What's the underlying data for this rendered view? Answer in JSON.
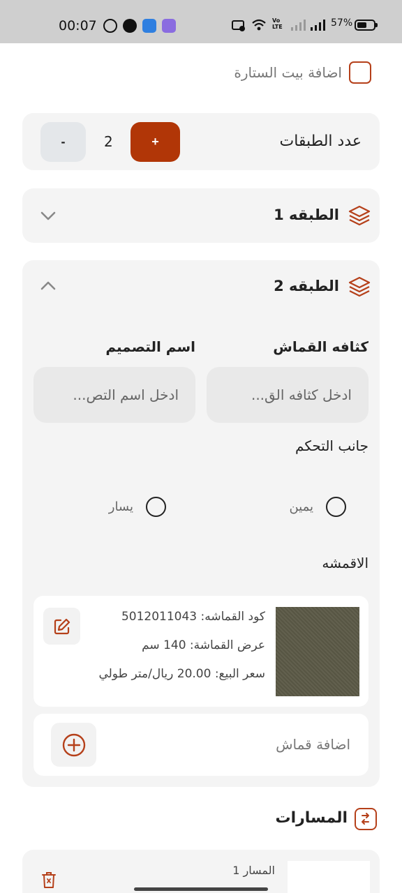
{
  "status_bar": {
    "time": "00:07",
    "battery_percent": "57%",
    "battery_level": 0.57,
    "network_label": "Vo LTE"
  },
  "add_curtain_house": {
    "label": "اضافة بيت الستارة",
    "checked": false
  },
  "layer_count": {
    "label": "عدد الطبقات",
    "value": "2",
    "plus_label": "+",
    "minus_label": "-"
  },
  "layers": [
    {
      "title": "الطبقه 1",
      "expanded": false
    },
    {
      "title": "الطبقه 2",
      "expanded": true
    }
  ],
  "layer2": {
    "fabric_density_label": "كثافه القماش",
    "fabric_density_placeholder": "ادخل كثافه الق...",
    "design_name_label": "اسم التصميم",
    "design_name_placeholder": "ادخل اسم التص...",
    "control_side_label": "جانب التحكم",
    "control_side_options": [
      "يمين",
      "يسار"
    ],
    "fabrics_label": "الاقمشه",
    "fabric": {
      "code_line": "كود القماشه: 5012011043",
      "width_line": "عرض القماشة: 140 سم",
      "price_line": "سعر البيع: 20.00 ريال/متر طولي"
    },
    "add_fabric_label": "اضافة قماش"
  },
  "tracks": {
    "title": "المسارات",
    "items": [
      {
        "name": "المسار 1"
      }
    ]
  },
  "colors": {
    "accent": "#b13607",
    "card_bg": "#f4f4f4"
  },
  "icons": {
    "layers": "layers-icon",
    "chevron_down": "chevron-down-icon",
    "chevron_up": "chevron-up-icon",
    "edit": "edit-icon",
    "add_circle": "plus-circle-icon",
    "swap": "swap-icon",
    "trash": "trash-icon"
  }
}
